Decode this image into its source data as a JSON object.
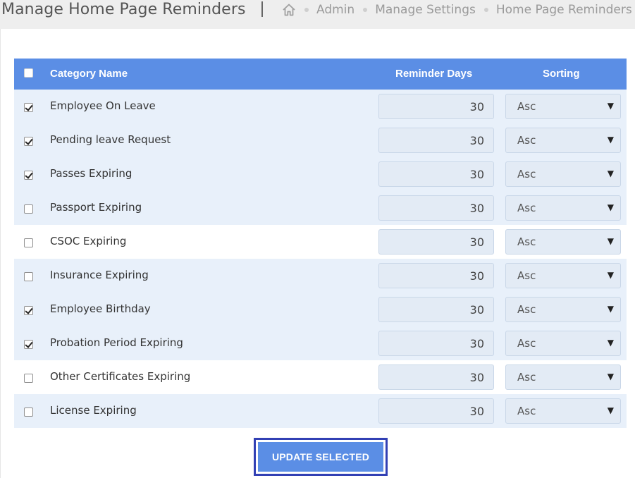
{
  "header": {
    "title": "Manage Home Page Reminders",
    "breadcrumb": [
      "Admin",
      "Manage Settings",
      "Home Page Reminders"
    ]
  },
  "table": {
    "columns": {
      "name": "Category Name",
      "days": "Reminder Days",
      "sorting": "Sorting"
    },
    "select_all_checked": false,
    "rows": [
      {
        "name": "Employee On Leave",
        "checked": true,
        "days": "30",
        "sort": "Asc"
      },
      {
        "name": "Pending leave Request",
        "checked": true,
        "days": "30",
        "sort": "Asc"
      },
      {
        "name": "Passes Expiring",
        "checked": true,
        "days": "30",
        "sort": "Asc"
      },
      {
        "name": "Passport Expiring",
        "checked": false,
        "days": "30",
        "sort": "Asc"
      },
      {
        "name": "CSOC Expiring",
        "checked": false,
        "days": "30",
        "sort": "Asc"
      },
      {
        "name": "Insurance Expiring",
        "checked": false,
        "days": "30",
        "sort": "Asc"
      },
      {
        "name": "Employee Birthday",
        "checked": true,
        "days": "30",
        "sort": "Asc"
      },
      {
        "name": "Probation Period Expiring",
        "checked": true,
        "days": "30",
        "sort": "Asc"
      },
      {
        "name": "Other Certificates Expiring",
        "checked": false,
        "days": "30",
        "sort": "Asc"
      },
      {
        "name": "License Expiring",
        "checked": false,
        "days": "30",
        "sort": "Asc"
      }
    ]
  },
  "actions": {
    "update_label": "UPDATE SELECTED"
  },
  "colors": {
    "header_blue": "#5b8ee5",
    "row_tint": "#e8f0fa",
    "focus_border": "#3240b4"
  },
  "icons": {
    "home": "home-icon",
    "caret": "caret-down-icon"
  }
}
